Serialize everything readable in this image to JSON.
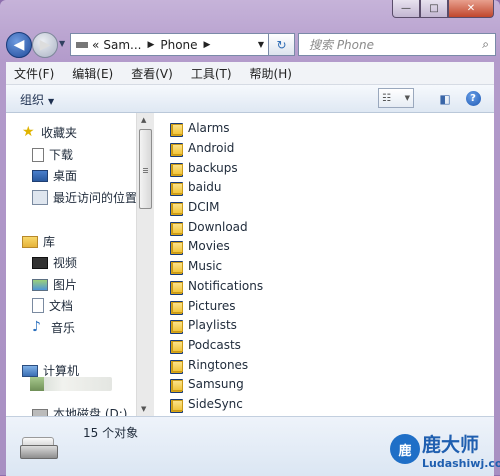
{
  "window": {
    "controls": {
      "minimize": "—",
      "maximize": "□",
      "close": "✕"
    }
  },
  "address": {
    "overflow": "«",
    "crumbs": [
      "Sam...",
      "Phone"
    ],
    "search_placeholder": "搜索 Phone"
  },
  "menu": [
    "文件(F)",
    "编辑(E)",
    "查看(V)",
    "工具(T)",
    "帮助(H)"
  ],
  "toolbar": {
    "organize": "组织",
    "help": "?"
  },
  "nav": {
    "favorites": "收藏夹",
    "downloads": "下载",
    "desktop": "桌面",
    "recent": "最近访问的位置",
    "libraries": "库",
    "videos": "视频",
    "pictures": "图片",
    "documents": "文档",
    "music": "音乐",
    "computer": "计算机",
    "local_disk": "本地磁盘 (D:)"
  },
  "folders": [
    "Alarms",
    "Android",
    "backups",
    "baidu",
    "DCIM",
    "Download",
    "Movies",
    "Music",
    "Notifications",
    "Pictures",
    "Playlists",
    "Podcasts",
    "Ringtones",
    "Samsung",
    "SideSync"
  ],
  "details": {
    "count": "15 个对象"
  },
  "watermark": {
    "logo": "鹿",
    "title": "鹿大师",
    "url": "Ludashiwj.com"
  }
}
